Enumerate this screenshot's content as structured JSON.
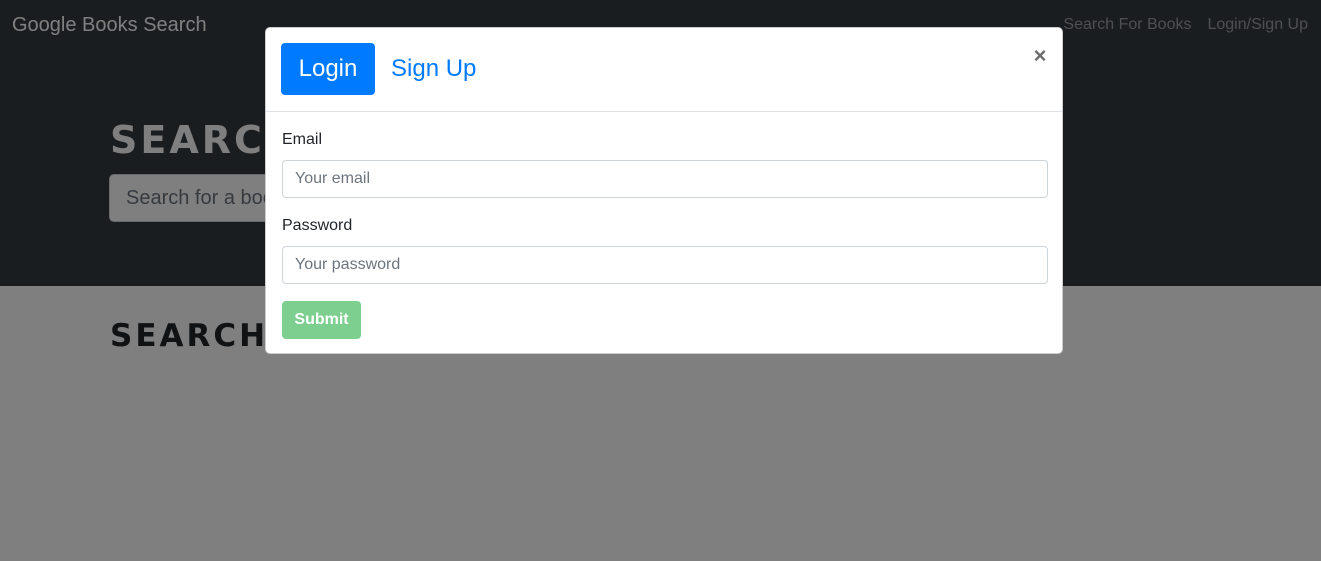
{
  "navbar": {
    "brand": "Google Books Search",
    "links": [
      "Search For Books",
      "Login/Sign Up"
    ]
  },
  "hero": {
    "title": "SEARCH",
    "search_placeholder": "Search for a book"
  },
  "results": {
    "title": "SEARCH"
  },
  "modal": {
    "tabs": {
      "login": "Login",
      "signup": "Sign Up"
    },
    "active_tab": "Login",
    "close_icon": "×",
    "email": {
      "label": "Email",
      "placeholder": "Your email",
      "value": ""
    },
    "password": {
      "label": "Password",
      "placeholder": "Your password",
      "value": ""
    },
    "submit_label": "Submit"
  },
  "colors": {
    "primary": "#007bff",
    "success_disabled": "#7ccf8f",
    "dark": "#343a40"
  }
}
